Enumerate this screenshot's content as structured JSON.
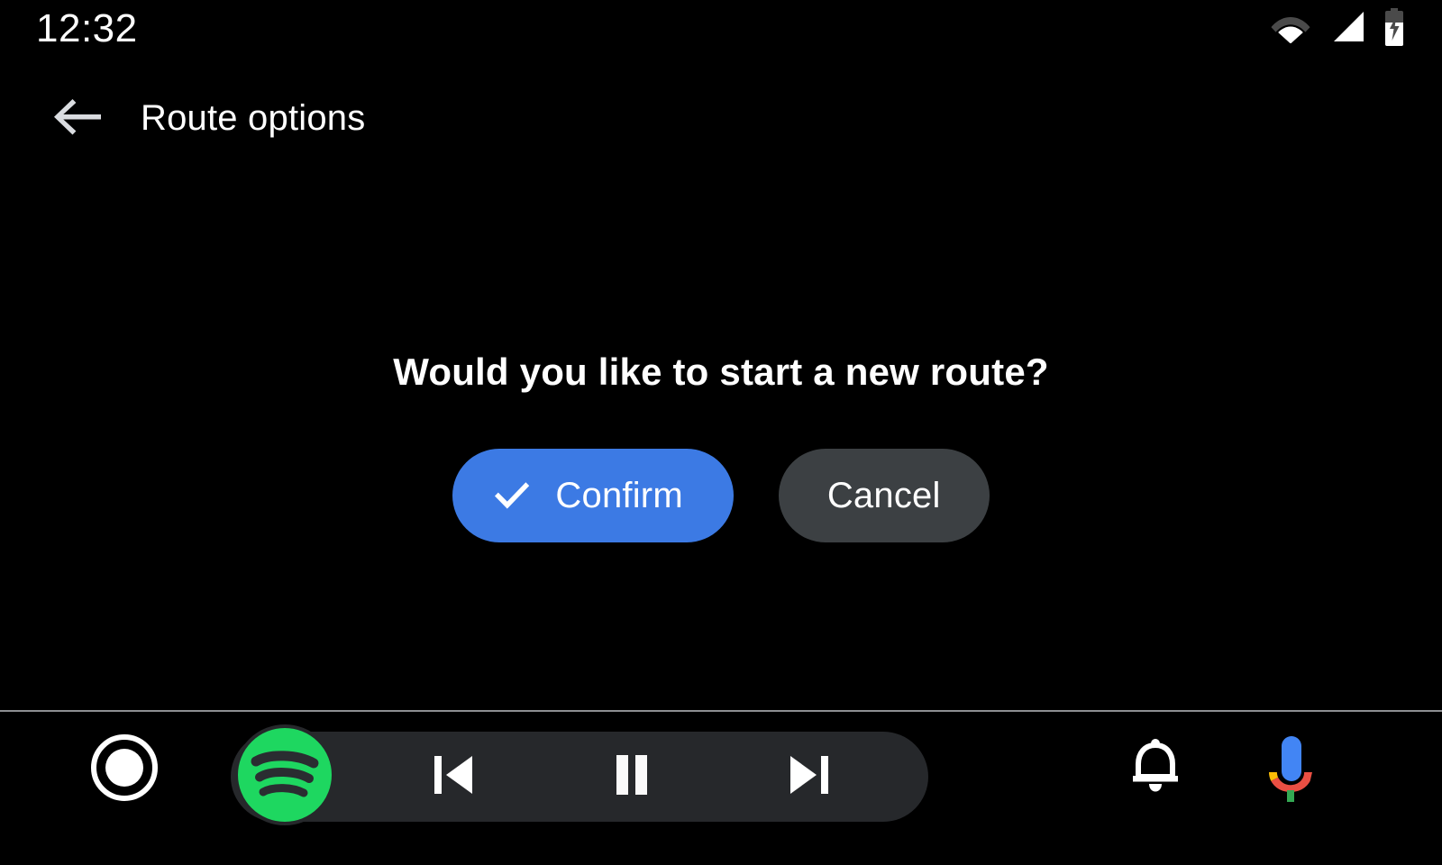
{
  "status_bar": {
    "clock": "12:32",
    "icons": [
      {
        "name": "wifi-icon",
        "label": "Wi-Fi"
      },
      {
        "name": "cell-signal-icon",
        "label": "Cellular signal"
      },
      {
        "name": "battery-charging-icon",
        "label": "Battery charging"
      }
    ]
  },
  "header": {
    "back_icon": "arrow-left-icon",
    "title": "Route options"
  },
  "dialog": {
    "prompt": "Would you like to start a new route?",
    "confirm": {
      "label": "Confirm",
      "icon": "check-icon",
      "color": "#3c7ae4"
    },
    "cancel": {
      "label": "Cancel",
      "color": "#3c4043"
    }
  },
  "bottom_bar": {
    "home": {
      "name": "home-circle-icon",
      "label": "Home"
    },
    "media": {
      "app_icon": "spotify-icon",
      "app_name": "Spotify",
      "app_color": "#1ed760",
      "pill_color": "#26282b",
      "controls": [
        {
          "name": "skip-previous-icon",
          "label": "Previous"
        },
        {
          "name": "pause-icon",
          "label": "Pause"
        },
        {
          "name": "skip-next-icon",
          "label": "Next"
        }
      ]
    },
    "notifications": {
      "name": "bell-icon",
      "label": "Notifications"
    },
    "assistant": {
      "name": "google-assistant-mic-icon",
      "label": "Google Assistant",
      "colors": {
        "body": "#4285f4",
        "left_arc": "#fbbc05",
        "right_arc": "#ea4f43",
        "stem": "#34a853"
      }
    }
  }
}
